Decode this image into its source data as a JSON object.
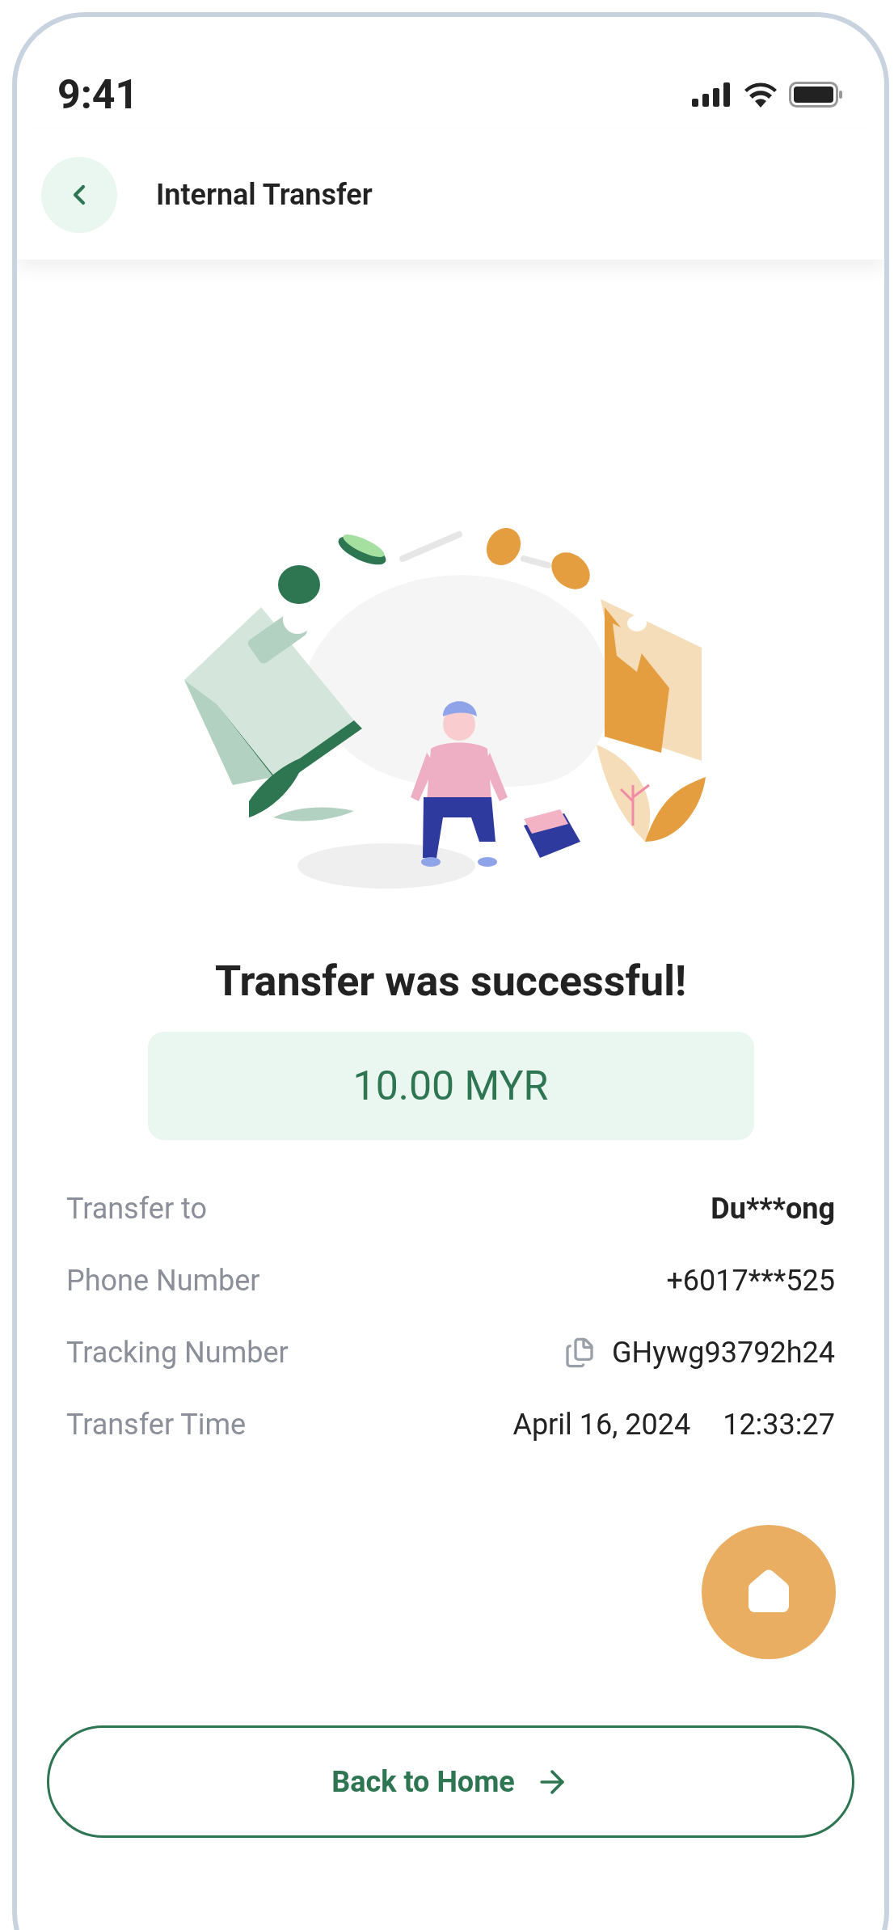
{
  "status_bar": {
    "time": "9:41"
  },
  "header": {
    "title": "Internal Transfer"
  },
  "result": {
    "message": "Transfer was successful!",
    "amount": "10.00 MYR"
  },
  "details": [
    {
      "label": "Transfer to",
      "kind": "bold",
      "value": "Du***ong"
    },
    {
      "label": "Phone Number",
      "kind": "plain",
      "value": "+6017***525"
    },
    {
      "label": "Tracking Number",
      "kind": "copy",
      "value": "GHywg93792h24"
    },
    {
      "label": "Transfer Time",
      "kind": "datetime",
      "value": "April 16, 2024",
      "value_2": "12:33:27"
    }
  ],
  "button": {
    "label": "Back to Home"
  }
}
